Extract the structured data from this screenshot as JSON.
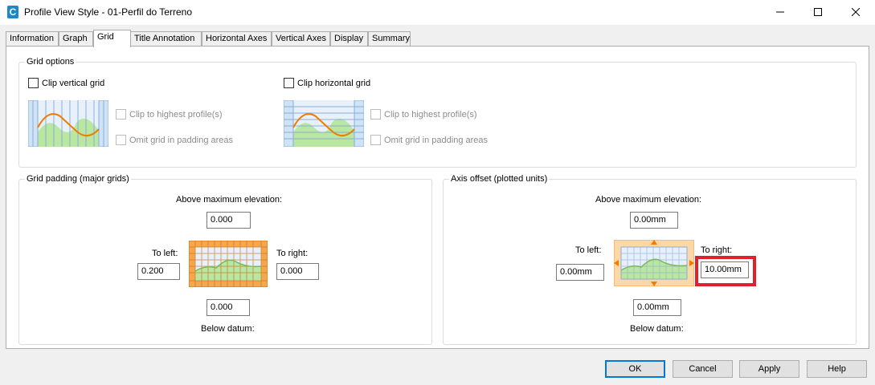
{
  "window": {
    "app_icon_letter": "C",
    "title": "Profile View Style - 01-Perfil do Terreno",
    "minimize_label": "—",
    "close_label": "✕"
  },
  "tabs": [
    "Information",
    "Graph",
    "Grid",
    "Title Annotation",
    "Horizontal Axes",
    "Vertical Axes",
    "Display",
    "Summary"
  ],
  "grid_options": {
    "legend": "Grid options",
    "clip_vertical": {
      "label": "Clip vertical grid",
      "checked": false
    },
    "clip_horizontal": {
      "label": "Clip horizontal grid",
      "checked": false
    },
    "vertical_subs": {
      "clip_highest": "Clip to highest profile(s)",
      "omit_padding": "Omit grid in padding areas"
    },
    "horizontal_subs": {
      "clip_highest": "Clip to highest profile(s)",
      "omit_padding": "Omit grid in padding areas"
    }
  },
  "grid_padding": {
    "legend": "Grid padding (major grids)",
    "above_label": "Above maximum elevation:",
    "above_value": "0.000",
    "left_label": "To left:",
    "left_value": "0.200",
    "right_label": "To right:",
    "right_value": "0.000",
    "below_value": "0.000",
    "below_label": "Below datum:"
  },
  "axis_offset": {
    "legend": "Axis offset (plotted units)",
    "above_label": "Above maximum elevation:",
    "above_value": "0.00mm",
    "left_label": "To left:",
    "left_value": "0.00mm",
    "right_label": "To right:",
    "right_value": "10.00mm",
    "below_value": "0.00mm",
    "below_label": "Below datum:"
  },
  "buttons": {
    "ok": "OK",
    "cancel": "Cancel",
    "apply": "Apply",
    "help": "Help"
  },
  "colors": {
    "accent": "#0078d7",
    "highlight": "#e0202a",
    "profile_line": "#f07c00",
    "grid_fill": "#b9e6a0",
    "padding": "#f7a64a"
  }
}
